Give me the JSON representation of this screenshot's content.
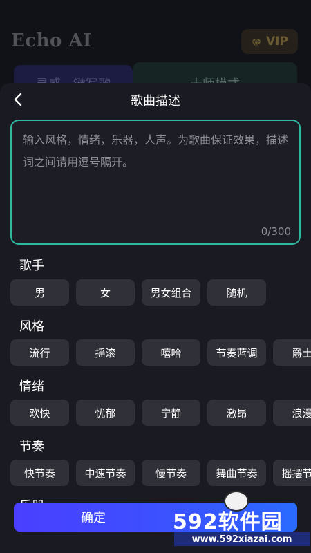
{
  "background": {
    "app_title": "Echo AI",
    "vip_label": "VIP",
    "tab_left": "灵感一键写歌",
    "tab_right": "大师模式"
  },
  "sheet": {
    "title": "歌曲描述",
    "description": {
      "placeholder": "输入风格，情绪，乐器，人声。为歌曲保证效果，描述词之间请用逗号隔开。",
      "value": "",
      "counter": "0/300"
    },
    "sections": [
      {
        "label": "歌手",
        "chips": [
          "男",
          "女",
          "男女组合",
          "随机"
        ]
      },
      {
        "label": "风格",
        "chips": [
          "流行",
          "摇滚",
          "嘻哈",
          "节奏蓝调",
          "爵士"
        ]
      },
      {
        "label": "情绪",
        "chips": [
          "欢快",
          "忧郁",
          "宁静",
          "激昂",
          "浪漫"
        ]
      },
      {
        "label": "节奏",
        "chips": [
          "快节奏",
          "中速节奏",
          "慢节奏",
          "舞曲节奏",
          "摇摆节奏"
        ]
      },
      {
        "label": "乐器",
        "chips": []
      }
    ],
    "confirm_label": "确定"
  },
  "watermark": {
    "main": "592软件园",
    "sub": "www.592xiazai.com"
  },
  "colors": {
    "accent_border": "#2fb8a0",
    "chip_bg": "#303038",
    "confirm_gradient_start": "#4a3fff",
    "confirm_gradient_end": "#2a6cff"
  }
}
